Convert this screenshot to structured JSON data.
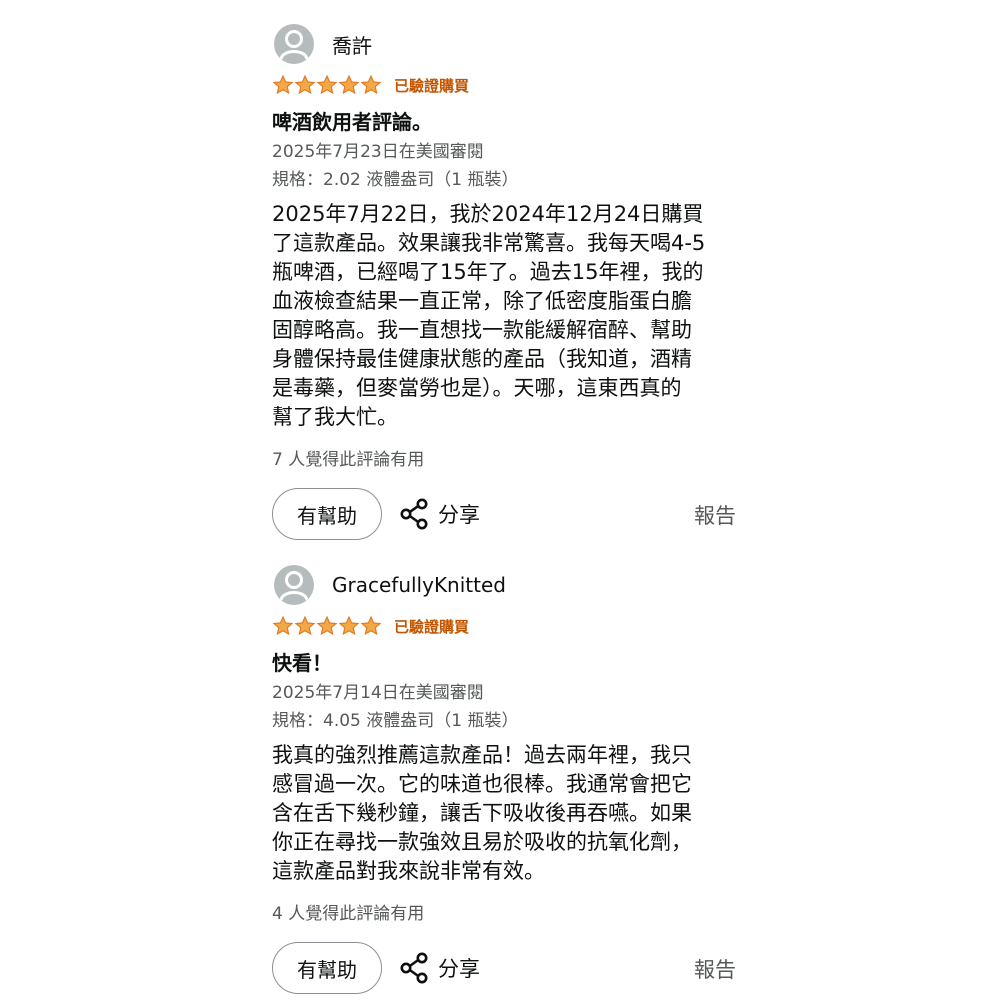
{
  "reviews": [
    {
      "username": "喬許",
      "rating": 5,
      "verified_label": "已驗證購買",
      "title": "啤酒飲用者評論。",
      "date": "2025年7月23日在美國審閱",
      "spec": "規格：2.02 液體盎司（1 瓶裝）",
      "body_lines": [
        "2025年7月22日，我於2024年12月24日購買",
        "了這款產品。效果讓我非常驚喜。我每天喝4-5",
        "瓶啤酒，已經喝了15年了。過去15年裡，我的",
        "血液檢查結果一直正常，除了低密度脂蛋白膽",
        "固醇略高。我一直想找一款能緩解宿醉、幫助",
        "身體保持最佳健康狀態的產品（我知道，酒精",
        "是毒藥，但麥當勞也是）。天哪，這東西真的",
        "幫了我大忙。"
      ],
      "helpful_count": "7 人覺得此評論有用",
      "helpful_button": "有幫助",
      "share_label": "分享",
      "report_label": "報告"
    },
    {
      "username": "GracefullyKnitted",
      "rating": 5,
      "verified_label": "已驗證購買",
      "title": "快看！",
      "date": "2025年7月14日在美國審閱",
      "spec": "規格：4.05 液體盎司（1 瓶裝）",
      "body_lines": [
        "我真的強烈推薦這款產品！過去兩年裡，我只",
        "感冒過一次。它的味道也很棒。我通常會把它",
        "含在舌下幾秒鐘，讓舌下吸收後再吞嚥。如果",
        "你正在尋找一款強效且易於吸收的抗氧化劑，",
        "這款產品對我來說非常有效。"
      ],
      "helpful_count": "4 人覺得此評論有用",
      "helpful_button": "有幫助",
      "share_label": "分享",
      "report_label": "報告"
    }
  ],
  "colors": {
    "star": "#f3a847",
    "star_stroke": "#de7921",
    "verified": "#c45500",
    "meta": "#565959"
  },
  "icons": {
    "avatar": "person-silhouette",
    "star": "star-filled",
    "share": "share-nodes"
  }
}
